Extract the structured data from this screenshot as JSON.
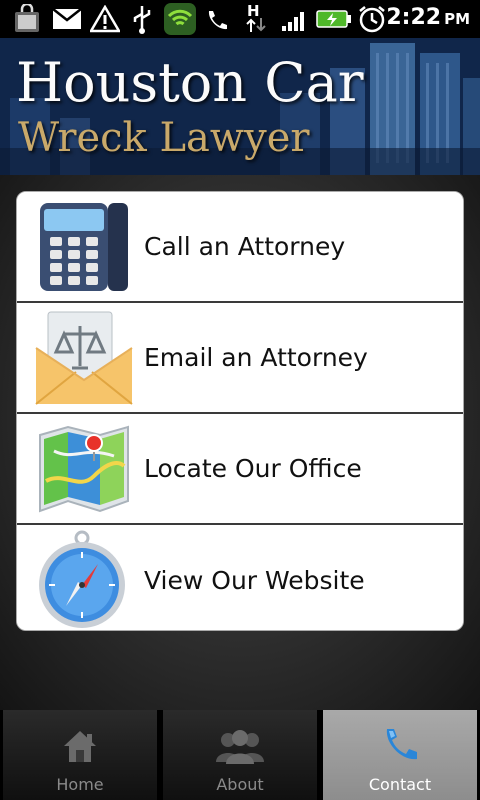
{
  "status_bar": {
    "time": "2:22",
    "ampm": "PM",
    "icons": [
      "bag-icon",
      "mail-icon",
      "warning-icon",
      "usb-icon",
      "wifi-shield-icon",
      "phone-call-icon",
      "h-signal-icon",
      "signal-bars-icon",
      "battery-charging-icon",
      "alarm-icon"
    ]
  },
  "header": {
    "title_line1": "Houston Car",
    "title_line2": "Wreck Lawyer"
  },
  "menu": {
    "items": [
      {
        "label": "Call an Attorney",
        "icon": "desk-phone-icon"
      },
      {
        "label": "Email an Attorney",
        "icon": "envelope-scales-icon"
      },
      {
        "label": "Locate Our Office",
        "icon": "map-pin-icon"
      },
      {
        "label": "View Our Website",
        "icon": "compass-icon"
      }
    ]
  },
  "tabs": [
    {
      "label": "Home",
      "icon": "home-icon",
      "active": false
    },
    {
      "label": "About",
      "icon": "people-icon",
      "active": false
    },
    {
      "label": "Contact",
      "icon": "phone-handset-icon",
      "active": true
    }
  ],
  "colors": {
    "banner_title": "#fbfbfb",
    "banner_subtitle": "#c9a96a",
    "active_tab": "#9b9b9b"
  }
}
